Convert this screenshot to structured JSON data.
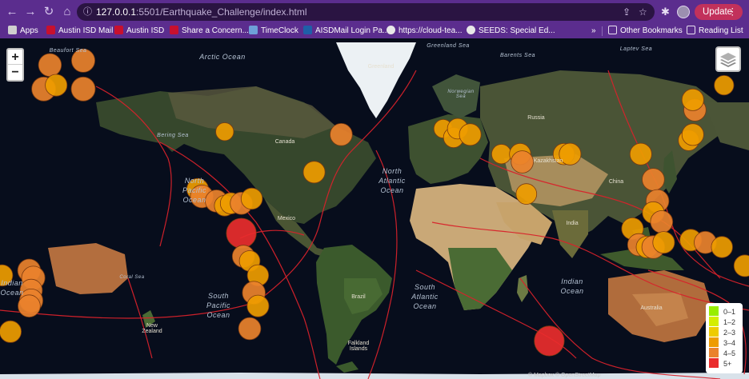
{
  "browser": {
    "url_host": "127.0.0.1",
    "url_path": ":5501/Earthquake_Challenge/index.html",
    "update_label": "Update",
    "bookmarks": [
      {
        "label": "Apps",
        "color": "#e0e0e0"
      },
      {
        "label": "Austin ISD Mail",
        "color": "#c8102e"
      },
      {
        "label": "Austin ISD",
        "color": "#c8102e"
      },
      {
        "label": "Share a Concern...",
        "color": "#c8102e"
      },
      {
        "label": "TimeClock",
        "color": "#6ea0d8"
      },
      {
        "label": "AISDMail Login Pa...",
        "color": "#1f5fa8"
      },
      {
        "label": "https://cloud-tea...",
        "color": "#e8e8e8"
      },
      {
        "label": "SEEDS: Special Ed...",
        "color": "#e8e8e8"
      }
    ],
    "more_bookmarks": "»",
    "other_bookmarks": "Other Bookmarks",
    "reading_list": "Reading List"
  },
  "map": {
    "zoom_in": "+",
    "zoom_out": "−",
    "labels": {
      "arctic": "Arctic Ocean",
      "greenland": "Greenland",
      "greenland_sea": "Greenland Sea",
      "barents": "Barents Sea",
      "laptev": "Laptev Sea",
      "beaufort": "Beaufort Sea",
      "bering": "Bering Sea",
      "north_pacific": "North Pacific Ocean",
      "north_atlantic": "North Atlantic Ocean",
      "south_pacific": "South Pacific Ocean",
      "south_atlantic": "South Atlantic Ocean",
      "indian": "Indian Ocean",
      "indian_left": "Indian Ocean",
      "canada": "Canada",
      "russia": "Russia",
      "brazil": "Brazil",
      "australia": "Australia",
      "china": "China",
      "kazakhstan": "Kazakhstan",
      "india": "India",
      "mexico": "Mexico",
      "new_zealand": "New Zealand",
      "coral_sea": "Coral Sea",
      "norwegian": "Norwegian Sea",
      "falkland": "Falkland Islands",
      "attribution": "© Mapbox © OpenStreetMap"
    },
    "quakes": [
      {
        "lon": -168,
        "lat": 58,
        "mag": 4.2
      },
      {
        "lon": -171,
        "lat": 52,
        "mag": 4.4
      },
      {
        "lon": -165,
        "lat": 53,
        "mag": 4.0
      },
      {
        "lon": -152,
        "lat": 59,
        "mag": 4.3
      },
      {
        "lon": -152,
        "lat": 52,
        "mag": 4.4
      },
      {
        "lon": -84,
        "lat": 39,
        "mag": 3.3
      },
      {
        "lon": -97,
        "lat": 17,
        "mag": 4.0
      },
      {
        "lon": -95,
        "lat": 14,
        "mag": 4.2
      },
      {
        "lon": -88,
        "lat": 12,
        "mag": 4.1
      },
      {
        "lon": -84,
        "lat": 10,
        "mag": 3.8
      },
      {
        "lon": -81,
        "lat": 11,
        "mag": 3.9
      },
      {
        "lon": -76,
        "lat": 11,
        "mag": 4.1
      },
      {
        "lon": -71,
        "lat": 13,
        "mag": 3.9
      },
      {
        "lon": -76,
        "lat": -2,
        "mag": 5.5
      },
      {
        "lon": -75,
        "lat": -12,
        "mag": 4.1
      },
      {
        "lon": -72,
        "lat": -14,
        "mag": 3.8
      },
      {
        "lon": -68,
        "lat": -20,
        "mag": 3.9
      },
      {
        "lon": -70,
        "lat": -27,
        "mag": 4.2
      },
      {
        "lon": -68,
        "lat": -32,
        "mag": 4.0
      },
      {
        "lon": -72,
        "lat": -40,
        "mag": 4.1
      },
      {
        "lon": -28,
        "lat": 38,
        "mag": 4.1
      },
      {
        "lon": -41,
        "lat": 24,
        "mag": 4.0
      },
      {
        "lon": 21,
        "lat": 40,
        "mag": 3.4
      },
      {
        "lon": 26,
        "lat": 37,
        "mag": 3.7
      },
      {
        "lon": 28,
        "lat": 40,
        "mag": 3.8
      },
      {
        "lon": 34,
        "lat": 38,
        "mag": 4.0
      },
      {
        "lon": 49,
        "lat": 31,
        "mag": 3.6
      },
      {
        "lon": 58,
        "lat": 31,
        "mag": 3.9
      },
      {
        "lon": 59,
        "lat": 28,
        "mag": 4.1
      },
      {
        "lon": 61,
        "lat": 15,
        "mag": 3.8
      },
      {
        "lon": 79,
        "lat": 31,
        "mag": 3.9
      },
      {
        "lon": 82,
        "lat": 31,
        "mag": 4.0
      },
      {
        "lon": 116,
        "lat": 31,
        "mag": 4.0
      },
      {
        "lon": 139,
        "lat": 36,
        "mag": 3.8
      },
      {
        "lon": 141,
        "lat": 38,
        "mag": 4.0
      },
      {
        "lon": 142,
        "lat": 46,
        "mag": 4.1
      },
      {
        "lon": 141,
        "lat": 49,
        "mag": 4.0
      },
      {
        "lon": 156,
        "lat": 53,
        "mag": 3.6
      },
      {
        "lon": 122,
        "lat": 21,
        "mag": 4.1
      },
      {
        "lon": 124,
        "lat": 12,
        "mag": 4.2
      },
      {
        "lon": 122,
        "lat": 7,
        "mag": 4.0
      },
      {
        "lon": 126,
        "lat": 3,
        "mag": 4.1
      },
      {
        "lon": 112,
        "lat": 0,
        "mag": 4.0
      },
      {
        "lon": 115,
        "lat": -7,
        "mag": 4.1
      },
      {
        "lon": 119,
        "lat": -8,
        "mag": 4.0
      },
      {
        "lon": 122,
        "lat": -8,
        "mag": 4.2
      },
      {
        "lon": 127,
        "lat": -6,
        "mag": 4.0
      },
      {
        "lon": 140,
        "lat": -5,
        "mag": 4.0
      },
      {
        "lon": 147,
        "lat": -6,
        "mag": 4.1
      },
      {
        "lon": 155,
        "lat": -8,
        "mag": 3.9
      },
      {
        "lon": 166,
        "lat": -16,
        "mag": 4.0
      },
      {
        "lon": 169,
        "lat": -20,
        "mag": 3.9
      },
      {
        "lon": -178,
        "lat": -18,
        "mag": 4.2
      },
      {
        "lon": -176,
        "lat": -21,
        "mag": 4.3
      },
      {
        "lon": -177,
        "lat": -26,
        "mag": 4.1
      },
      {
        "lon": -177,
        "lat": -30,
        "mag": 4.3
      },
      {
        "lon": -178,
        "lat": -32,
        "mag": 4.1
      },
      {
        "lon": 72,
        "lat": -44,
        "mag": 5.5
      },
      {
        "lon": -28,
        "lat": -57,
        "mag": 4.0
      },
      {
        "lon": -27,
        "lat": -59,
        "mag": 3.9
      },
      {
        "lon": 173,
        "lat": -41,
        "mag": 4.0
      }
    ]
  },
  "legend": {
    "items": [
      {
        "label": "0–1",
        "color": "#98ee00"
      },
      {
        "label": "1–2",
        "color": "#d4ee00"
      },
      {
        "label": "2–3",
        "color": "#eecc00"
      },
      {
        "label": "3–4",
        "color": "#ee9c00"
      },
      {
        "label": "4–5",
        "color": "#ea822c"
      },
      {
        "label": "5+",
        "color": "#ea2c2c"
      }
    ]
  }
}
